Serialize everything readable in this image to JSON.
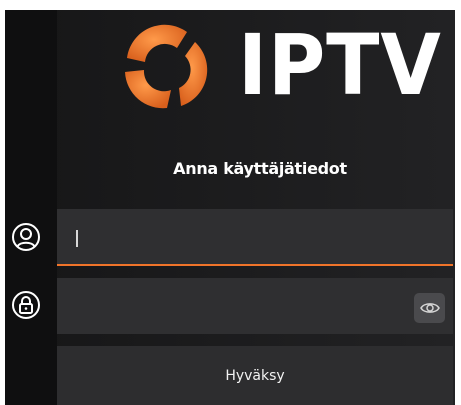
{
  "logo": {
    "text": "IPTV",
    "colors": {
      "mark": "#f0742a",
      "mark_shadow": "#c4561a",
      "text": "#ffffff"
    }
  },
  "heading": "Anna käyttäjätiedot",
  "username": {
    "icon": "user-icon",
    "value": "",
    "placeholder": ""
  },
  "password": {
    "icon": "lock-icon",
    "value": "",
    "placeholder": "",
    "toggle_icon": "eye-icon"
  },
  "accept_label": "Hyväksy",
  "colors": {
    "accent": "#f0742a",
    "background": "#1b1b1c",
    "field": "#2f2f31",
    "button": "#2d2d2f"
  }
}
